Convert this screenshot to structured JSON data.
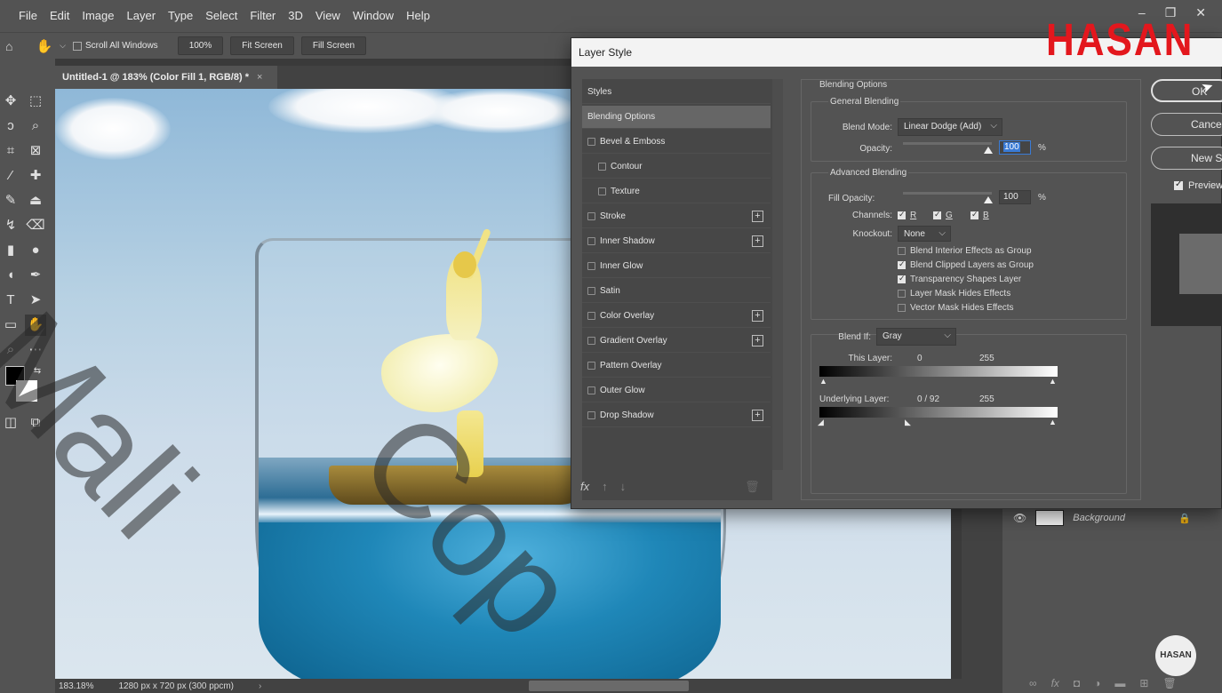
{
  "menubar": {
    "items": [
      "File",
      "Edit",
      "Image",
      "Layer",
      "Type",
      "Select",
      "Filter",
      "3D",
      "View",
      "Window",
      "Help"
    ]
  },
  "optionsbar": {
    "scroll_all_label": "Scroll All Windows",
    "zoom_label": "100%",
    "fit_label": "Fit Screen",
    "fill_label": "Fill Screen"
  },
  "document": {
    "tab_title": "Untitled-1 @ 183% (Color Fill 1, RGB/8) *",
    "close": "×"
  },
  "statusbar": {
    "zoom": "183.18%",
    "size": "1280 px x 720 px (300 ppcm)"
  },
  "watermark": {
    "text1": "Mali",
    "text2": "Cop"
  },
  "layers": {
    "background_name": "Background"
  },
  "badge": {
    "text": "HASAN"
  },
  "dialog": {
    "title": "Layer Style",
    "logo": "HASAN",
    "styles": [
      {
        "label": "Styles"
      },
      {
        "label": "Blending Options"
      },
      {
        "label": "Bevel & Emboss"
      },
      {
        "label": "Contour"
      },
      {
        "label": "Texture"
      },
      {
        "label": "Stroke"
      },
      {
        "label": "Inner Shadow"
      },
      {
        "label": "Inner Glow"
      },
      {
        "label": "Satin"
      },
      {
        "label": "Color Overlay"
      },
      {
        "label": "Gradient Overlay"
      },
      {
        "label": "Pattern Overlay"
      },
      {
        "label": "Outer Glow"
      },
      {
        "label": "Drop Shadow"
      }
    ],
    "blending": {
      "section_title": "Blending Options",
      "general_title": "General Blending",
      "blend_mode_label": "Blend Mode:",
      "blend_mode_value": "Linear Dodge (Add)",
      "opacity_label": "Opacity:",
      "opacity_value": "100",
      "percent": "%",
      "advanced_title": "Advanced Blending",
      "fill_opacity_label": "Fill Opacity:",
      "fill_opacity_value": "100",
      "channels_label": "Channels:",
      "channel_r": "R",
      "channel_g": "G",
      "channel_b": "B",
      "knockout_label": "Knockout:",
      "knockout_value": "None",
      "chk_interior": "Blend Interior Effects as Group",
      "chk_clipped": "Blend Clipped Layers as Group",
      "chk_transparency": "Transparency Shapes Layer",
      "chk_layer_mask": "Layer Mask Hides Effects",
      "chk_vector_mask": "Vector Mask Hides Effects",
      "blend_if_label": "Blend If:",
      "blend_if_value": "Gray",
      "this_layer_label": "This Layer:",
      "this_layer_low": "0",
      "this_layer_high": "255",
      "underlying_label": "Underlying Layer:",
      "underlying_low": "0  /  92",
      "underlying_high": "255"
    },
    "buttons": {
      "ok": "OK",
      "cancel": "Cancel",
      "new_style": "New Style...",
      "preview": "Preview"
    }
  }
}
